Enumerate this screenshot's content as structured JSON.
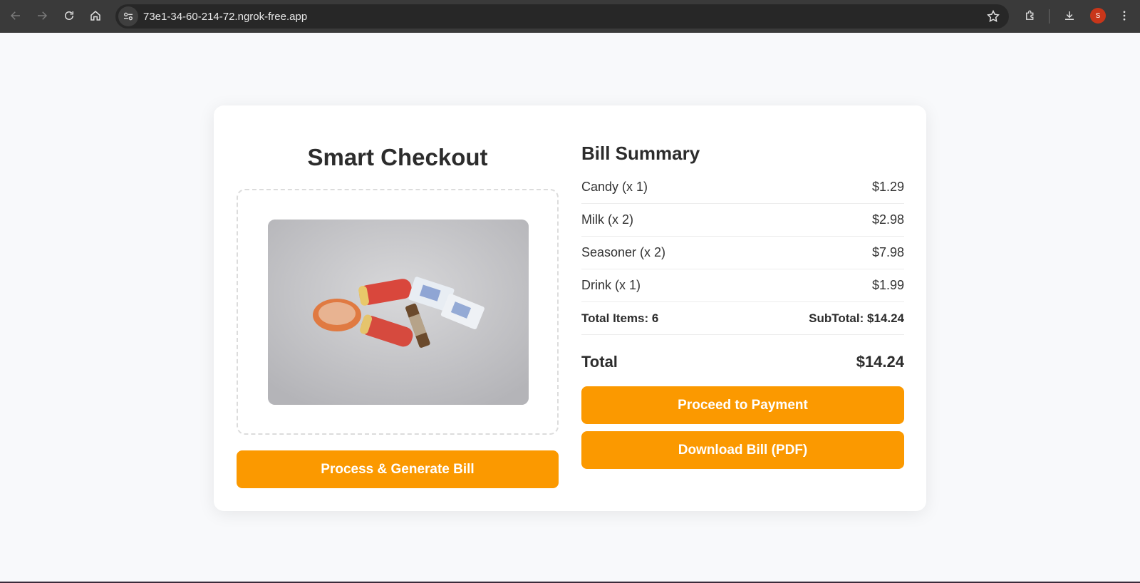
{
  "browser": {
    "url": "73e1-34-60-214-72.ngrok-free.app",
    "profile_initial": "S",
    "icons": [
      "back-icon",
      "forward-icon",
      "reload-icon",
      "home-icon",
      "site-info-icon",
      "star-icon",
      "extensions-icon",
      "download-icon",
      "menu-icon"
    ]
  },
  "app": {
    "title": "Smart Checkout",
    "process_button": "Process & Generate Bill"
  },
  "bill": {
    "title": "Bill Summary",
    "items": [
      {
        "name": "Candy (x 1)",
        "price": "$1.29"
      },
      {
        "name": "Milk (x 2)",
        "price": "$2.98"
      },
      {
        "name": "Seasoner (x 2)",
        "price": "$7.98"
      },
      {
        "name": "Drink (x 1)",
        "price": "$1.99"
      }
    ],
    "total_items": "Total Items: 6",
    "subtotal": "SubTotal: $14.24",
    "total_label": "Total",
    "total_value": "$14.24",
    "pay_button": "Proceed to Payment",
    "pdf_button": "Download Bill (PDF)"
  },
  "colors": {
    "accent": "#fb9900",
    "chrome": "#3a3a3a",
    "page_bg": "#f8f9fb"
  }
}
